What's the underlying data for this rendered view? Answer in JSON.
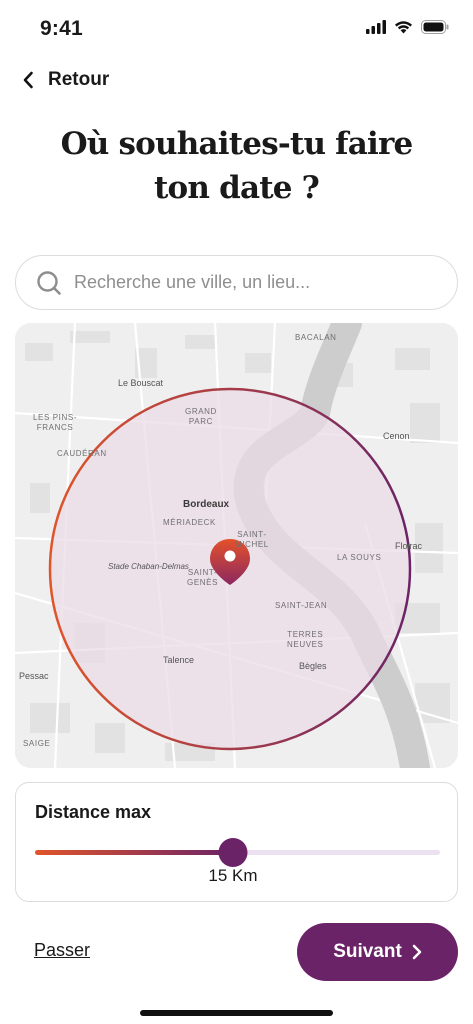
{
  "status_bar": {
    "time": "9:41",
    "icons": [
      "signal-icon",
      "wifi-icon",
      "battery-icon"
    ]
  },
  "header": {
    "back_label": "Retour"
  },
  "title": {
    "line1": "Où souhaites-tu faire",
    "line2": "ton date ?"
  },
  "search": {
    "placeholder": "Recherche une ville, un lieu..."
  },
  "map": {
    "places": {
      "bacalan": "BACALAN",
      "le_bouscat": "Le Bouscat",
      "les_pins_francs": "LES PINS-\nFRANCS",
      "grand_parc": "GRAND\nPARC",
      "cenon": "Cenon",
      "cauderan": "CAUDÉRAN",
      "bordeaux": "Bordeaux",
      "meriadeck": "MÉRIADECK",
      "saint_michel": "SAINT-\nMICHEL",
      "stade": "Stade Chaban-Delmas",
      "saint_genes": "SAINT-\nGENÈS",
      "la_souys": "LA SOUYS",
      "floirac": "Floirac",
      "saint_jean": "SAINT-JEAN",
      "terres_neuves": "TERRES\nNEUVES",
      "talence": "Talence",
      "begles": "Bègles",
      "pessac": "Pessac",
      "saige": "SAIGE"
    },
    "radius_color_start": "#e0552a",
    "radius_color_end": "#6b2367",
    "fill_color": "#eadbe6"
  },
  "distance": {
    "label": "Distance max",
    "value_text": "15 Km",
    "level_fraction": 0.49
  },
  "footer": {
    "skip_label": "Passer",
    "next_label": "Suivant"
  },
  "colors": {
    "primary": "#6b2367",
    "accent": "#e0552a",
    "track": "#ece1f1"
  }
}
